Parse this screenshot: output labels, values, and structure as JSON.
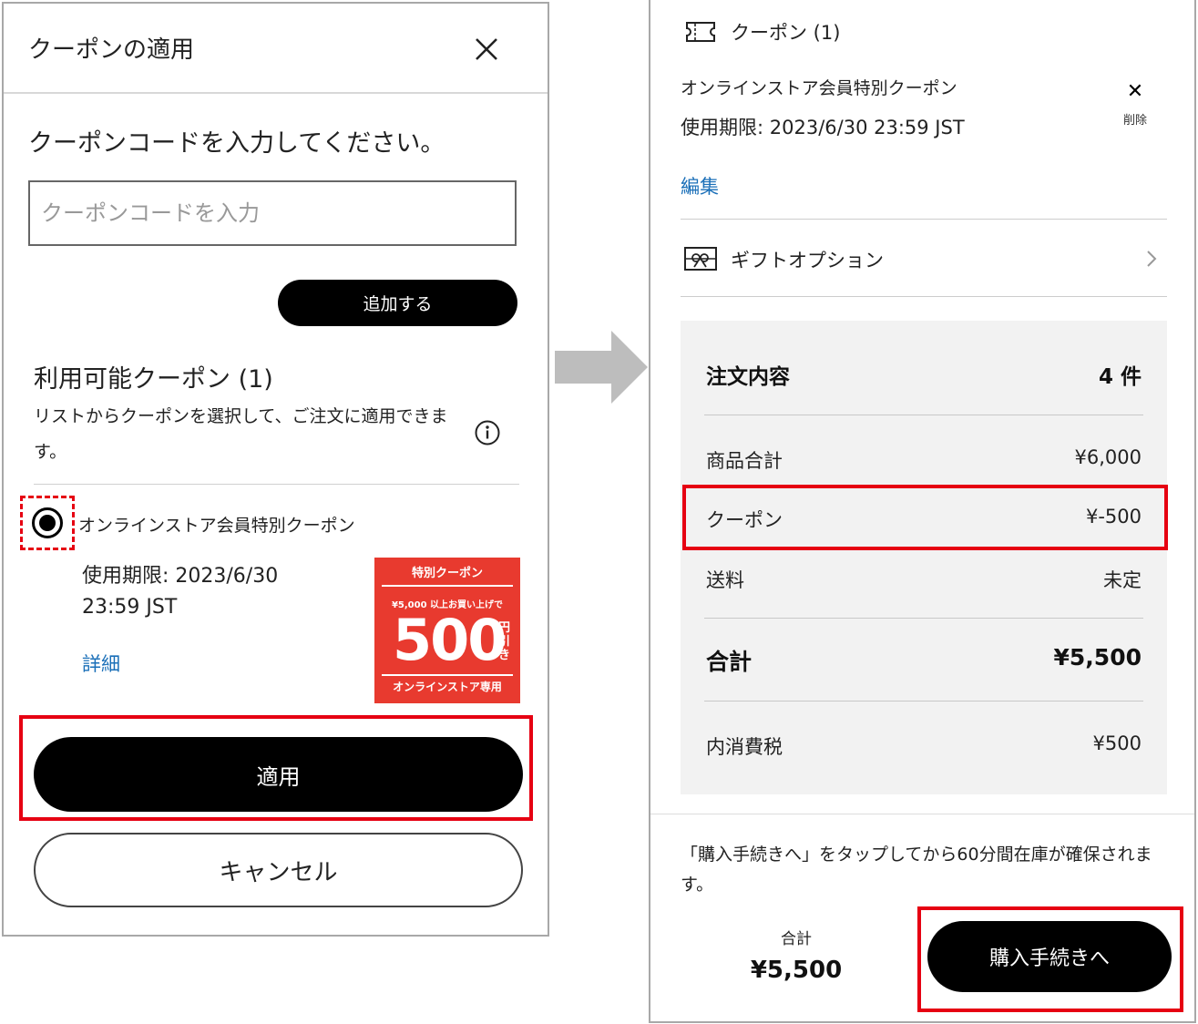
{
  "left_dialog": {
    "title": "クーポンの適用",
    "prompt": "クーポンコードを入力してください。",
    "code_placeholder": "クーポンコードを入力",
    "add_button": "追加する",
    "available_heading": "利用可能クーポン (1)",
    "available_description": "リストからクーポンを選択して、ご注文に適用できます。",
    "coupon": {
      "name": "オンラインストア会員特別クーポン",
      "expiry": "使用期限: 2023/6/30 23:59 JST",
      "detail_link": "詳細",
      "selected": true,
      "image": {
        "title": "特別クーポン",
        "condition": "¥5,000 以上お買い上げで",
        "amount": "500",
        "unit": "円引き",
        "footer": "オンラインストア専用"
      }
    },
    "apply_button": "適用",
    "cancel_button": "キャンセル"
  },
  "right_cart": {
    "coupon_header": "クーポン (1)",
    "coupon_name": "オンラインストア会員特別クーポン",
    "coupon_expiry": "使用期限: 2023/6/30 23:59 JST",
    "delete_label": "削除",
    "edit_link": "編集",
    "gift_option": "ギフトオプション",
    "summary": {
      "heading": "注文内容",
      "count": "4 件",
      "subtotal_label": "商品合計",
      "subtotal_value": "¥6,000",
      "coupon_label": "クーポン",
      "coupon_value": "¥-500",
      "shipping_label": "送料",
      "shipping_value": "未定",
      "total_label": "合計",
      "total_value": "¥5,500",
      "tax_label": "内消費税",
      "tax_value": "¥500"
    },
    "notice": "「購入手続きへ」をタップしてから60分間在庫が確保されます。",
    "footer_total_label": "合計",
    "footer_total_value": "¥5,500",
    "purchase_button": "購入手続きへ"
  },
  "colors": {
    "highlight_red": "#e60012",
    "link_blue": "#1a6fb8",
    "coupon_red": "#e83a2f",
    "summary_bg": "#f2f2f2",
    "arrow_gray": "#bdbdbd"
  }
}
